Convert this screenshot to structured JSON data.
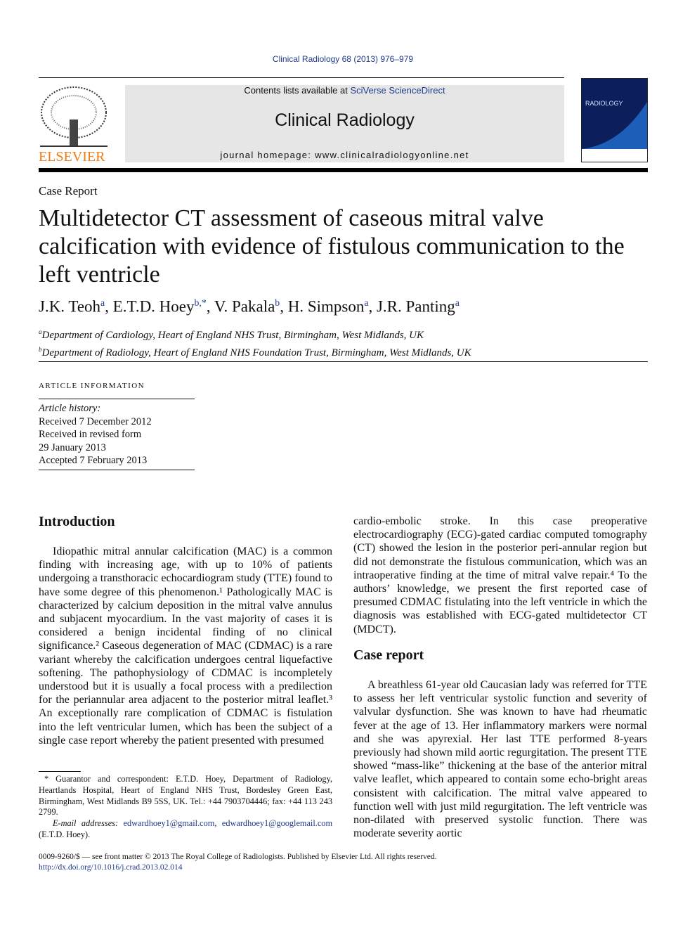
{
  "header": {
    "citation": "Clinical Radiology 68 (2013) 976–979",
    "contents_prefix": "Contents lists available at ",
    "contents_link": "SciVerse ScienceDirect",
    "journal_title": "Clinical Radiology",
    "homepage": "journal homepage: www.clinicalradiologyonline.net",
    "publisher_logo": "ELSEVIER",
    "cover_text": "clinical RADIOLOGY"
  },
  "article": {
    "type": "Case Report",
    "title": "Multidetector CT assessment of caseous mitral valve calcification with evidence of fistulous communication to the left ventricle",
    "authors": [
      {
        "name": "J.K. Teoh",
        "sup": "a"
      },
      {
        "name": "E.T.D. Hoey",
        "sup": "b,*"
      },
      {
        "name": "V. Pakala",
        "sup": "b"
      },
      {
        "name": "H. Simpson",
        "sup": "a"
      },
      {
        "name": "J.R. Panting",
        "sup": "a"
      }
    ],
    "affiliations": [
      {
        "sup": "a",
        "text": "Department of Cardiology, Heart of England NHS Trust, Birmingham, West Midlands, UK"
      },
      {
        "sup": "b",
        "text": "Department of Radiology, Heart of England NHS Foundation Trust, Birmingham, West Midlands, UK"
      }
    ]
  },
  "article_info": {
    "heading": "ARTICLE INFORMATION",
    "history_label": "Article history:",
    "history": [
      "Received 7 December 2012",
      "Received in revised form",
      "29 January 2013",
      "Accepted 7 February 2013"
    ]
  },
  "body": {
    "intro_heading": "Introduction",
    "intro_text": "Idiopathic mitral annular calcification (MAC) is a common finding with increasing age, with up to 10% of patients undergoing a transthoracic echocardiogram study (TTE) found to have some degree of this phenomenon.¹ Pathologically MAC is characterized by calcium deposition in the mitral valve annulus and subjacent myocardium. In the vast majority of cases it is considered a benign incidental finding of no clinical significance.² Caseous degeneration of MAC (CDMAC) is a rare variant whereby the calcification undergoes central liquefactive softening. The pathophysiology of CDMAC is incompletely understood but it is usually a focal process with a predilection for the periannular area adjacent to the posterior mitral leaflet.³ An exceptionally rare complication of CDMAC is fistulation into the left ventricular lumen, which has been the subject of a single case report whereby the patient presented with presumed",
    "intro_cont": "cardio-embolic stroke. In this case preoperative electrocardiography (ECG)-gated cardiac computed tomography (CT) showed the lesion in the posterior peri-annular region but did not demonstrate the fistulous communication, which was an intraoperative finding at the time of mitral valve repair.⁴ To the authors’ knowledge, we present the first reported case of presumed CDMAC fistulating into the left ventricle in which the diagnosis was established with ECG-gated multidetector CT (MDCT).",
    "case_heading": "Case report",
    "case_text": "A breathless 61-year old Caucasian lady was referred for TTE to assess her left ventricular systolic function and severity of valvular dysfunction. She was known to have had rheumatic fever at the age of 13. Her inflammatory markers were normal and she was apyrexial. Her last TTE performed 8-years previously had shown mild aortic regurgitation. The present TTE showed “mass-like” thickening at the base of the anterior mitral valve leaflet, which appeared to contain some echo-bright areas consistent with calcification. The mitral valve appeared to function well with just mild regurgitation. The left ventricle was non-dilated with preserved systolic function. There was moderate severity aortic"
  },
  "footnote": {
    "text": "* Guarantor and correspondent: E.T.D. Hoey, Department of Radiology, Heartlands Hospital, Heart of England NHS Trust, Bordesley Green East, Birmingham, West Midlands B9 5SS, UK. Tel.: +44 7903704446; fax: +44 113 243 2799.",
    "email_label": "E-mail addresses:",
    "email1": "edwardhoey1@gmail.com",
    "email2": "edwardhoey1@googlemail.com",
    "email_suffix": " (E.T.D. Hoey)."
  },
  "footer": {
    "rights": "0009-9260/$ — see front matter © 2013 The Royal College of Radiologists. Published by Elsevier Ltd. All rights reserved.",
    "doi": "http://dx.doi.org/10.1016/j.crad.2013.02.014"
  }
}
